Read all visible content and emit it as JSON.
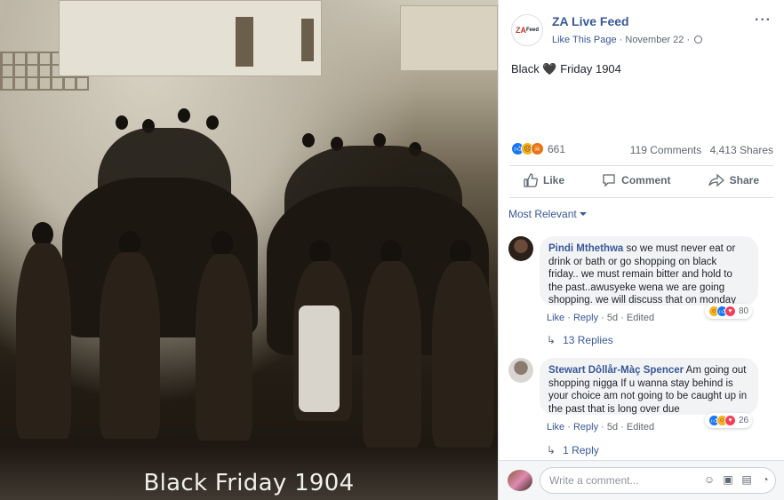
{
  "photo": {
    "caption": "Black Friday 1904"
  },
  "post": {
    "page_name": "ZA Live Feed",
    "avatar_text": "ZA",
    "avatar_sub": "Feed",
    "like_page": "Like This Page",
    "date": "November 22",
    "separator": "·",
    "text_before": "Black",
    "heart": "🖤",
    "text_after": "Friday 1904",
    "reaction_count": "661",
    "comments": "119 Comments",
    "shares": "4,413 Shares",
    "more": "···"
  },
  "actions": {
    "like": "Like",
    "comment": "Comment",
    "share": "Share"
  },
  "sort": {
    "label": "Most Relevant"
  },
  "comments": [
    {
      "author": "Pindi Mthethwa",
      "text": "so we must never eat or drink or bath or go shopping on black friday.. we must remain bitter and hold to the past..awusyeke wena we are going shopping. we will discuss that on monday",
      "like": "Like",
      "reply": "Reply",
      "age": "5d",
      "edited": "Edited",
      "reactions": "80",
      "replies": "13 Replies"
    },
    {
      "author": "Stewart Dôllår-Màç Spencer",
      "text": "Am going out shopping nigga If u wanna stay behind is your choice am not going to be caught up in the past that is long over due",
      "like": "Like",
      "reply": "Reply",
      "age": "5d",
      "edited": "Edited",
      "reactions": "26",
      "replies": "1 Reply"
    }
  ],
  "composer": {
    "placeholder": "Write a comment..."
  },
  "colors": {
    "link": "#385898",
    "like_blue": "#1877f2",
    "love_red": "#f33e58",
    "haha_yellow": "#f7b125"
  }
}
